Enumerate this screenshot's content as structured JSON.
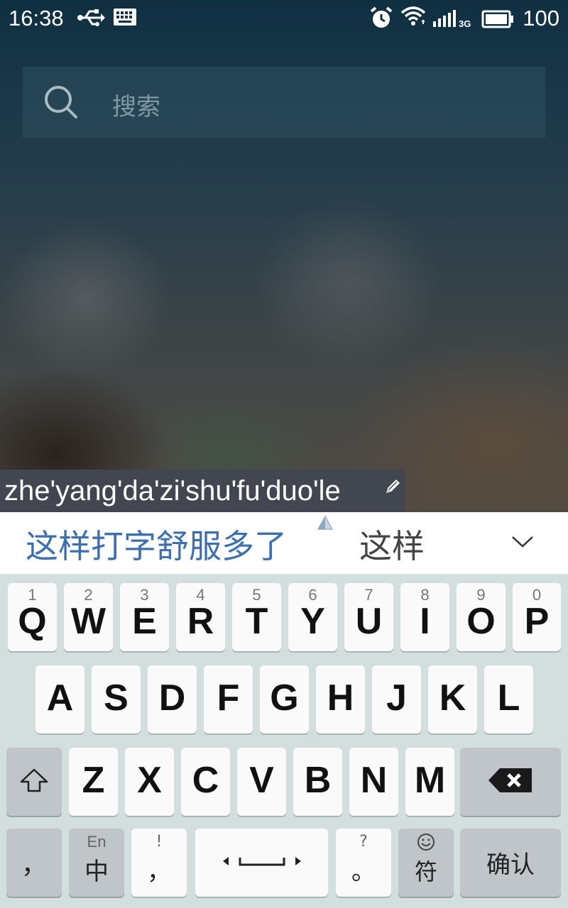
{
  "status_bar": {
    "time": "16:38",
    "battery_level": "100",
    "network_type": "3G",
    "icons": [
      "usb-icon",
      "keyboard-icon",
      "alarm-icon",
      "wifi-icon",
      "cellular-signal-icon",
      "battery-icon"
    ]
  },
  "search": {
    "placeholder": "搜索",
    "icon": "search-icon"
  },
  "ime": {
    "composition_text": "zhe'yang'da'zi'shu'fu'duo'le",
    "candidates": {
      "primary": "这样打字舒服多了",
      "secondary": "这样"
    },
    "rows": {
      "row1": [
        {
          "letter": "Q",
          "num": "1"
        },
        {
          "letter": "W",
          "num": "2"
        },
        {
          "letter": "E",
          "num": "3"
        },
        {
          "letter": "R",
          "num": "4"
        },
        {
          "letter": "T",
          "num": "5"
        },
        {
          "letter": "Y",
          "num": "6"
        },
        {
          "letter": "U",
          "num": "7"
        },
        {
          "letter": "I",
          "num": "8"
        },
        {
          "letter": "O",
          "num": "9"
        },
        {
          "letter": "P",
          "num": "0"
        }
      ],
      "row2": [
        "A",
        "S",
        "D",
        "F",
        "G",
        "H",
        "J",
        "K",
        "L"
      ],
      "row3": [
        "Z",
        "X",
        "C",
        "V",
        "B",
        "N",
        "M"
      ]
    },
    "bottom_row": {
      "comma": "，",
      "lang_top": "En",
      "lang_main": "中",
      "punct_top": "!",
      "punct_main": "，",
      "period_top": "?",
      "period_main": "。",
      "symbol_label": "符",
      "confirm_label": "确认"
    }
  }
}
